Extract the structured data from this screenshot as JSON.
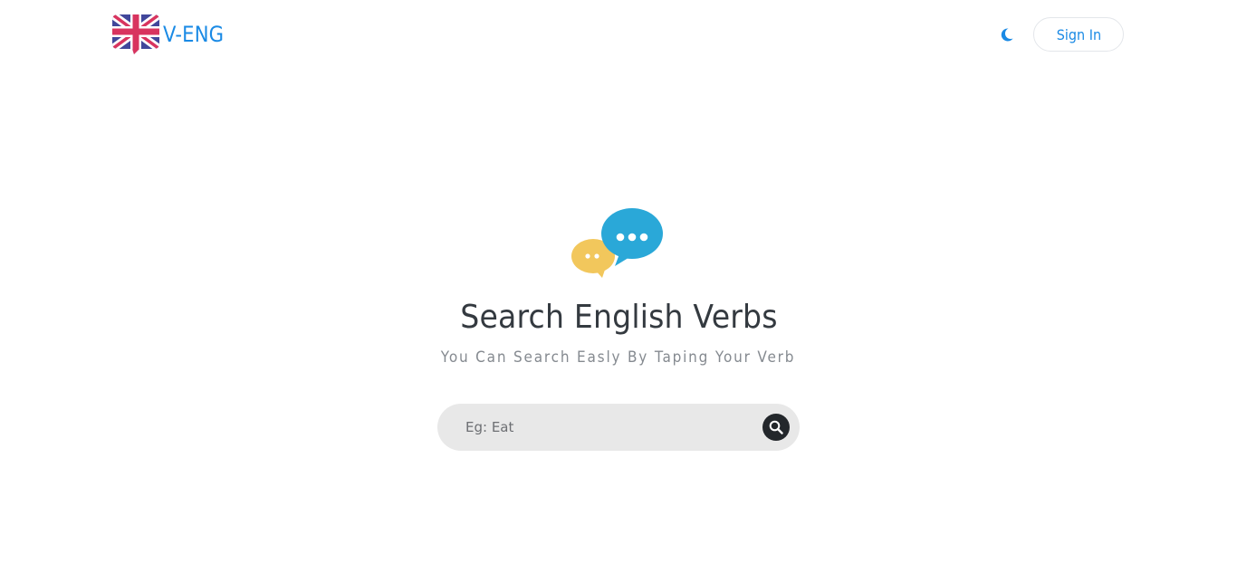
{
  "header": {
    "brand_name": "V-ENG",
    "logo_icon": "uk-flag-icon",
    "theme_toggle_icon": "moon-icon",
    "signin_label": "Sign In"
  },
  "hero": {
    "icon": "chat-bubbles-icon",
    "title": "Search English Verbs",
    "subtitle": "You Can Search Easly By Taping Your Verb"
  },
  "search": {
    "placeholder": "Eg: Eat",
    "value": "",
    "button_icon": "search-icon"
  },
  "colors": {
    "accent": "#1a8ae5",
    "title": "#343a40",
    "subtitle": "#858a90",
    "search_bg": "#e8e8e8",
    "search_button": "#23272b",
    "bubble_blue": "#2aa8d8",
    "bubble_yellow": "#f2c75c"
  }
}
